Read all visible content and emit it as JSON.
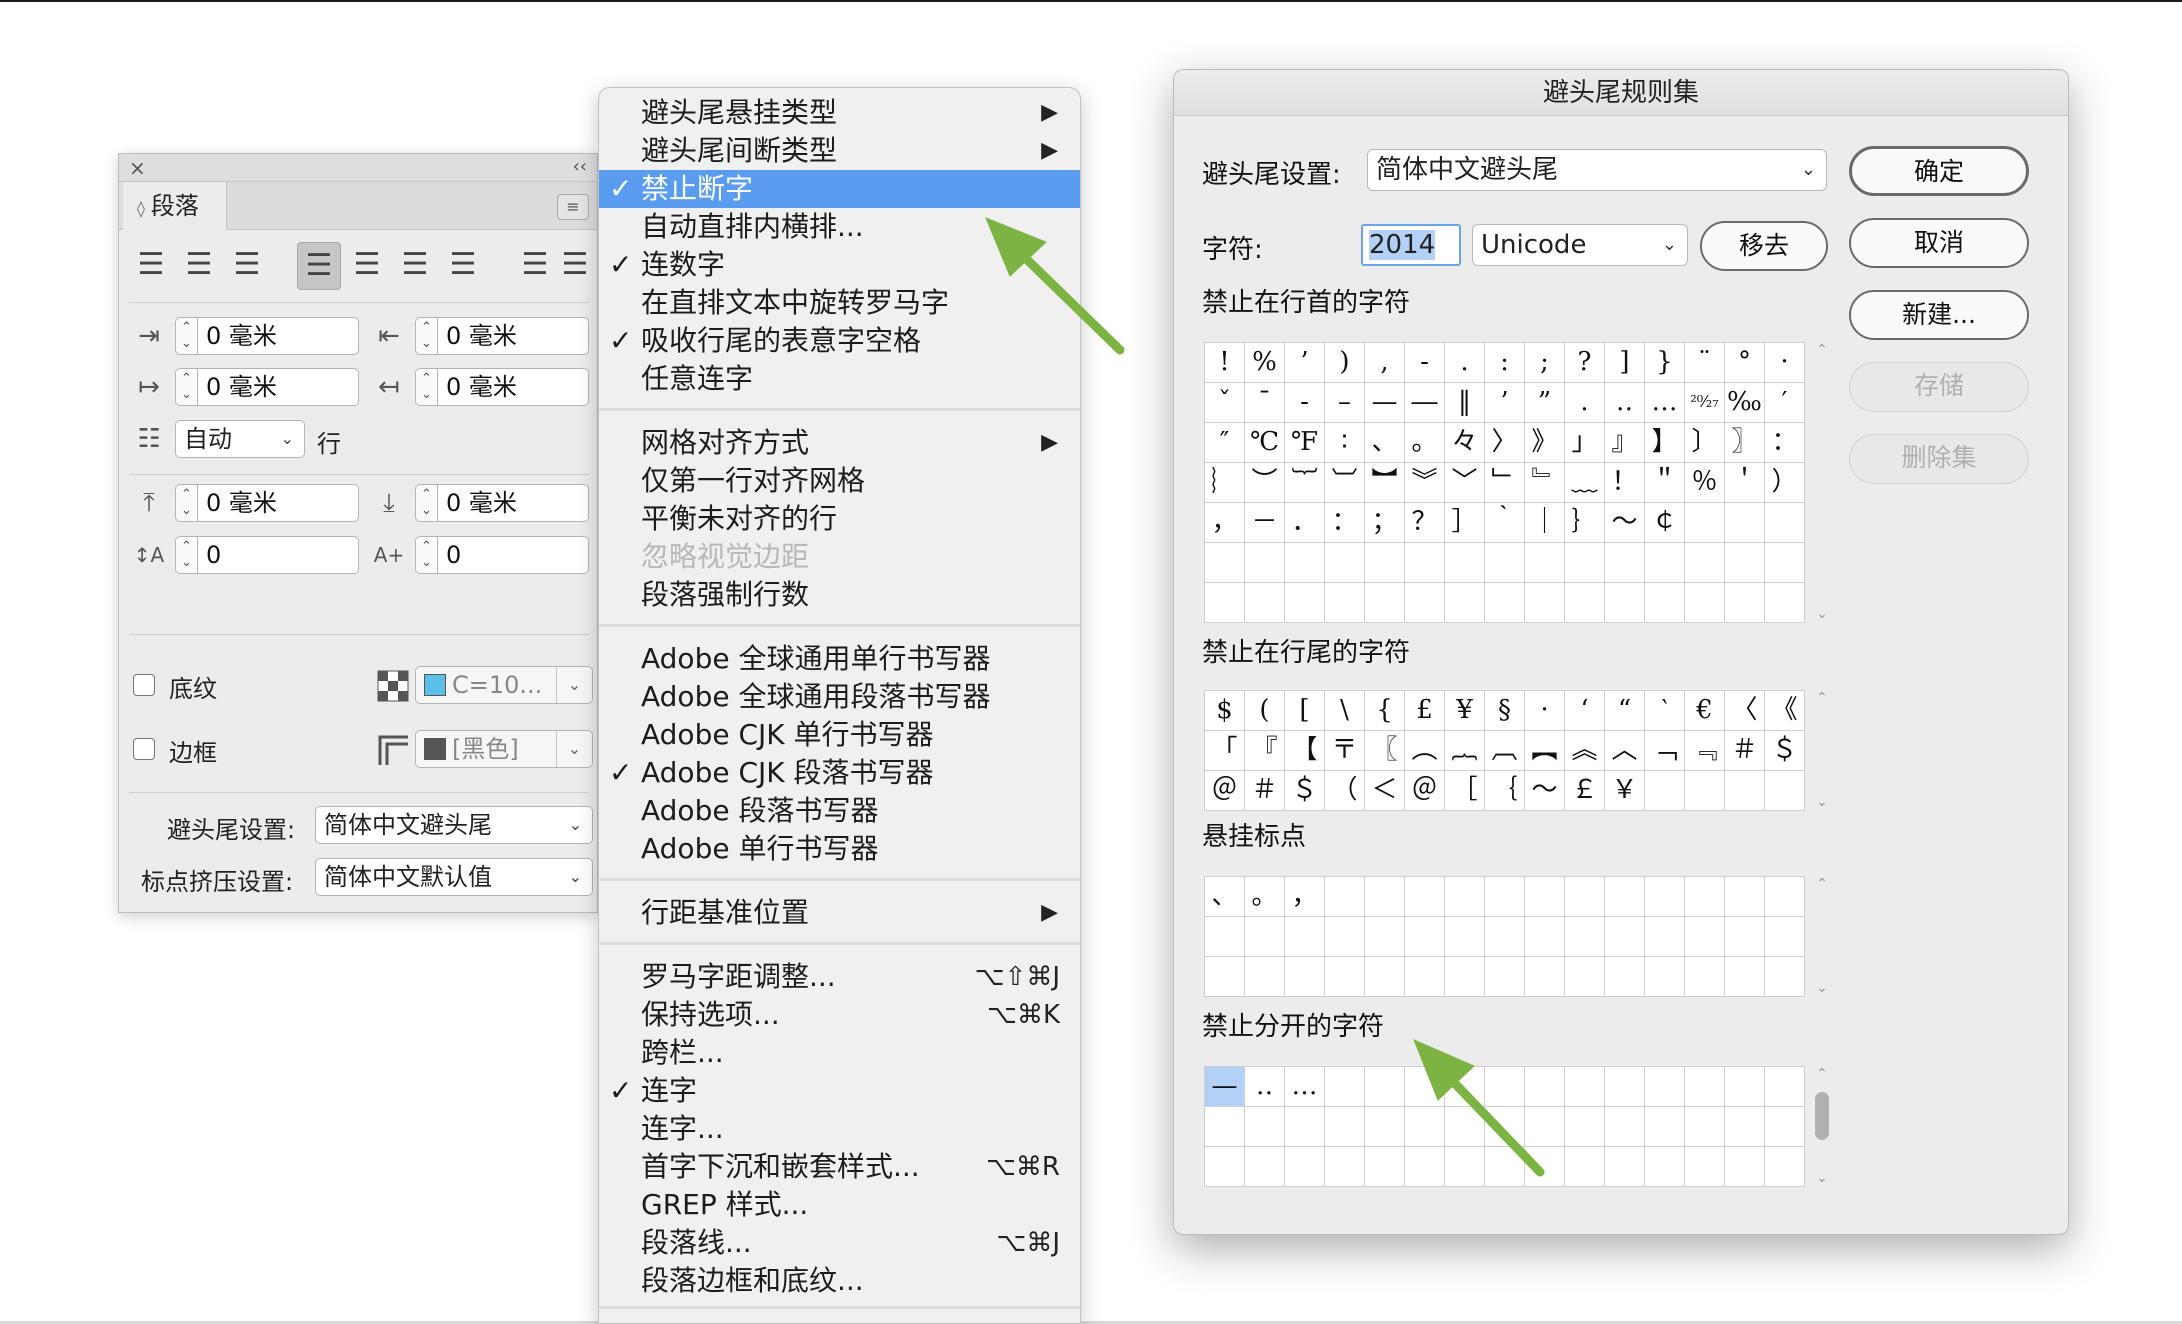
{
  "paragraph_panel": {
    "close_glyph": "×",
    "collapse_glyph": "‹‹",
    "tab_arrows": "◊",
    "tab_label": "段落",
    "menu_glyph": "≡",
    "align_buttons": [
      {
        "name": "align-left-icon",
        "glyph": "☰",
        "selected": false
      },
      {
        "name": "align-center-icon",
        "glyph": "☰",
        "selected": false
      },
      {
        "name": "align-right-icon",
        "glyph": "☰",
        "selected": false
      },
      {
        "name": "justify-left-icon",
        "glyph": "☰",
        "selected": true
      },
      {
        "name": "justify-center-icon",
        "glyph": "☰",
        "selected": false
      },
      {
        "name": "justify-right-icon",
        "glyph": "☰",
        "selected": false
      },
      {
        "name": "justify-all-icon",
        "glyph": "☰",
        "selected": false
      },
      {
        "name": "align-spine-icon",
        "glyph": "☰",
        "selected": false
      },
      {
        "name": "align-away-spine-icon",
        "glyph": "☰",
        "selected": false
      }
    ],
    "left_indent": "0 毫米",
    "right_indent": "0 毫米",
    "first_line_indent": "0 毫米",
    "last_line_indent": "0 毫米",
    "leading_select": "自动",
    "leading_unit": "行",
    "space_before": "0 毫米",
    "space_after": "0 毫米",
    "dropcap_lines": "0",
    "dropcap_chars": "0",
    "shading_label": "底纹",
    "shading_color": "C=10...",
    "shading_swatch": "#5bbfea",
    "border_label": "边框",
    "border_color": "[黑色]",
    "border_swatch": "#555555",
    "kinsoku_label": "避头尾设置:",
    "kinsoku_value": "简体中文避头尾",
    "mojikumi_label": "标点挤压设置:",
    "mojikumi_value": "简体中文默认值",
    "stepper_glyph": "⌃\n⌄",
    "dropdown_glyph": "⌄"
  },
  "context_menu": {
    "check_glyph": "✓",
    "submenu_glyph": "▶",
    "items": [
      {
        "label": "避头尾悬挂类型",
        "submenu": true
      },
      {
        "label": "避头尾间断类型",
        "submenu": true
      },
      {
        "label": "禁止断字",
        "checked": true,
        "highlighted": true
      },
      {
        "label": "自动直排内横排..."
      },
      {
        "label": "连数字",
        "checked": true
      },
      {
        "label": "在直排文本中旋转罗马字"
      },
      {
        "label": "吸收行尾的表意字空格",
        "checked": true
      },
      {
        "label": "任意连字"
      },
      {
        "label": "网格对齐方式",
        "submenu": true
      },
      {
        "label": "仅第一行对齐网格"
      },
      {
        "label": "平衡未对齐的行"
      },
      {
        "label": "忽略视觉边距",
        "disabled": true
      },
      {
        "label": "段落强制行数"
      },
      {
        "label": "Adobe 全球通用单行书写器"
      },
      {
        "label": "Adobe 全球通用段落书写器"
      },
      {
        "label": "Adobe CJK 单行书写器"
      },
      {
        "label": "Adobe CJK 段落书写器",
        "checked": true
      },
      {
        "label": "Adobe 段落书写器"
      },
      {
        "label": "Adobe 单行书写器"
      },
      {
        "label": "行距基准位置",
        "submenu": true
      },
      {
        "label": "罗马字距调整...",
        "shortcut": "⌥⇧⌘J"
      },
      {
        "label": "保持选项...",
        "shortcut": "⌥⌘K"
      },
      {
        "label": "跨栏..."
      },
      {
        "label": "连字",
        "checked": true
      },
      {
        "label": "连字..."
      },
      {
        "label": "首字下沉和嵌套样式...",
        "shortcut": "⌥⌘R"
      },
      {
        "label": "GREP 样式..."
      },
      {
        "label": "段落线...",
        "shortcut": "⌥⌘J"
      },
      {
        "label": "段落边框和底纹..."
      }
    ]
  },
  "kinsoku_dialog": {
    "title": "避头尾规则集",
    "set_label": "避头尾设置:",
    "set_value": "简体中文避头尾",
    "char_label": "字符:",
    "char_input": "2014",
    "encoding_value": "Unicode",
    "remove_button": "移去",
    "buttons": {
      "ok": "确定",
      "cancel": "取消",
      "new": "新建...",
      "save": "存储",
      "delete": "删除集"
    },
    "sections": {
      "not_begin": {
        "label": "禁止在行首的字符",
        "rows": [
          [
            "!",
            "%",
            "’",
            ")",
            ",",
            "-",
            ".",
            ":",
            ";",
            "?",
            "]",
            "}",
            "¨",
            "°",
            "·"
          ],
          [
            "ˇ",
            "ˉ",
            "‐",
            "–",
            "—",
            "―",
            "‖",
            "’",
            "”",
            "․",
            "‥",
            "…",
            "²⁰⁄₂₇",
            "‰",
            "′"
          ],
          [
            "″",
            "℃",
            "℉",
            "∶",
            "、",
            "。",
            "々",
            "〉",
            "》",
            "」",
            "』",
            "】",
            "〕",
            "〗",
            "："
          ],
          [
            "︴",
            "︶",
            "︸",
            "︺",
            "︼",
            "︾",
            "﹀",
            "﹂",
            "﹄",
            "﹏",
            "！",
            "＂",
            "％",
            "＇",
            "）"
          ],
          [
            "，",
            "－",
            "．",
            "：",
            "；",
            "？",
            "］",
            "｀",
            "｜",
            "｝",
            "～",
            "￠",
            "",
            "",
            ""
          ],
          [
            "",
            "",
            "",
            "",
            "",
            "",
            "",
            "",
            "",
            "",
            "",
            "",
            "",
            "",
            ""
          ],
          [
            "",
            "",
            "",
            "",
            "",
            "",
            "",
            "",
            "",
            "",
            "",
            "",
            "",
            "",
            ""
          ]
        ]
      },
      "not_end": {
        "label": "禁止在行尾的字符",
        "rows": [
          [
            "$",
            "(",
            "[",
            "\\",
            "{",
            "£",
            "¥",
            "§",
            "·",
            "‘",
            "“",
            "‵",
            "€",
            "〈",
            "《"
          ],
          [
            "「",
            "『",
            "【",
            "〒",
            "〖",
            "︵",
            "︷",
            "︹",
            "︻",
            "︽",
            "︿",
            "﹁",
            "﹃",
            "＃",
            "＄"
          ],
          [
            "＠",
            "＃",
            "＄",
            "（",
            "＜",
            "＠",
            "［",
            "｛",
            "～",
            "￡",
            "￥",
            "",
            "",
            "",
            ""
          ]
        ]
      },
      "hanging": {
        "label": "悬挂标点",
        "rows": [
          [
            "、",
            "。",
            "，",
            "",
            "",
            "",
            "",
            "",
            "",
            "",
            "",
            "",
            "",
            "",
            ""
          ],
          [
            "",
            "",
            "",
            "",
            "",
            "",
            "",
            "",
            "",
            "",
            "",
            "",
            "",
            "",
            ""
          ],
          [
            "",
            "",
            "",
            "",
            "",
            "",
            "",
            "",
            "",
            "",
            "",
            "",
            "",
            "",
            ""
          ]
        ]
      },
      "no_split": {
        "label": "禁止分开的字符",
        "rows": [
          [
            "—",
            "‥",
            "…",
            "",
            "",
            "",
            "",
            "",
            "",
            "",
            "",
            "",
            "",
            "",
            ""
          ],
          [
            "",
            "",
            "",
            "",
            "",
            "",
            "",
            "",
            "",
            "",
            "",
            "",
            "",
            "",
            ""
          ],
          [
            "",
            "",
            "",
            "",
            "",
            "",
            "",
            "",
            "",
            "",
            "",
            "",
            "",
            "",
            ""
          ]
        ]
      }
    },
    "scroll_up": "⌃",
    "scroll_down": "⌄"
  },
  "annotations": {
    "arrow_color": "#7cb342"
  }
}
